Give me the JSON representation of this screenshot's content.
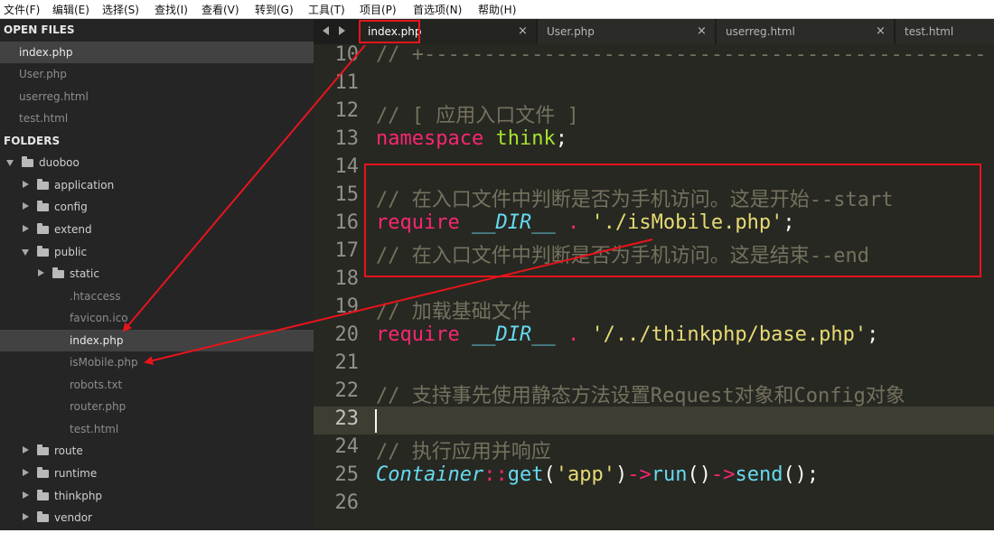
{
  "menu": [
    "文件(F)",
    "编辑(E)",
    "选择(S)",
    "查找(I)",
    "查看(V)",
    "转到(G)",
    "工具(T)",
    "项目(P)",
    "首选项(N)",
    "帮助(H)"
  ],
  "sidebar": {
    "open_files_header": "OPEN FILES",
    "open_files": [
      "index.php",
      "User.php",
      "userreg.html",
      "test.html"
    ],
    "folders_header": "FOLDERS",
    "tree": [
      {
        "label": "duoboo",
        "type": "folder",
        "expanded": true
      },
      {
        "label": "application",
        "type": "folder",
        "expanded": false
      },
      {
        "label": "config",
        "type": "folder",
        "expanded": false
      },
      {
        "label": "extend",
        "type": "folder",
        "expanded": false
      },
      {
        "label": "public",
        "type": "folder",
        "expanded": true
      },
      {
        "label": "static",
        "type": "folder",
        "expanded": false
      },
      {
        "label": ".htaccess",
        "type": "file"
      },
      {
        "label": "favicon.ico",
        "type": "file"
      },
      {
        "label": "index.php",
        "type": "file",
        "selected": true
      },
      {
        "label": "isMobile.php",
        "type": "file"
      },
      {
        "label": "robots.txt",
        "type": "file"
      },
      {
        "label": "router.php",
        "type": "file"
      },
      {
        "label": "test.html",
        "type": "file"
      },
      {
        "label": "route",
        "type": "folder",
        "expanded": false
      },
      {
        "label": "runtime",
        "type": "folder",
        "expanded": false
      },
      {
        "label": "thinkphp",
        "type": "folder",
        "expanded": false
      },
      {
        "label": "vendor",
        "type": "folder",
        "expanded": false
      }
    ]
  },
  "tabs": [
    {
      "label": "index.php",
      "active": true
    },
    {
      "label": "User.php",
      "active": false
    },
    {
      "label": "userreg.html",
      "active": false
    },
    {
      "label": "test.html",
      "active": false
    }
  ],
  "tab_close_glyph": "×",
  "editor": {
    "current_line": 23,
    "lines": [
      {
        "n": "10",
        "tokens": [
          {
            "t": "// +-----------------------------------------------",
            "c": "cmt"
          }
        ]
      },
      {
        "n": "11",
        "tokens": []
      },
      {
        "n": "12",
        "tokens": [
          {
            "t": "// [ 应用入口文件 ]",
            "c": "cmt"
          }
        ]
      },
      {
        "n": "13",
        "tokens": [
          {
            "t": "namespace",
            "c": "kw"
          },
          {
            "t": " ",
            "c": "pl"
          },
          {
            "t": "think",
            "c": "ns"
          },
          {
            "t": ";",
            "c": "pl"
          }
        ]
      },
      {
        "n": "14",
        "tokens": []
      },
      {
        "n": "15",
        "tokens": [
          {
            "t": "// 在入口文件中判断是否为手机访问。这是开始--start",
            "c": "cmt"
          }
        ]
      },
      {
        "n": "16",
        "tokens": [
          {
            "t": "require",
            "c": "kw"
          },
          {
            "t": " ",
            "c": "pl"
          },
          {
            "t": "__DIR__",
            "c": "cls"
          },
          {
            "t": " ",
            "c": "pl"
          },
          {
            "t": ".",
            "c": "kw"
          },
          {
            "t": " ",
            "c": "pl"
          },
          {
            "t": "'./isMobile.php'",
            "c": "str"
          },
          {
            "t": ";",
            "c": "pl"
          }
        ]
      },
      {
        "n": "17",
        "tokens": [
          {
            "t": "// 在入口文件中判断是否为手机访问。这是结束--end",
            "c": "cmt"
          }
        ]
      },
      {
        "n": "18",
        "tokens": []
      },
      {
        "n": "19",
        "tokens": [
          {
            "t": "// 加载基础文件",
            "c": "cmt"
          }
        ]
      },
      {
        "n": "20",
        "tokens": [
          {
            "t": "require",
            "c": "kw"
          },
          {
            "t": " ",
            "c": "pl"
          },
          {
            "t": "__DIR__",
            "c": "cls"
          },
          {
            "t": " ",
            "c": "pl"
          },
          {
            "t": ".",
            "c": "kw"
          },
          {
            "t": " ",
            "c": "pl"
          },
          {
            "t": "'/../thinkphp/base.php'",
            "c": "str"
          },
          {
            "t": ";",
            "c": "pl"
          }
        ]
      },
      {
        "n": "21",
        "tokens": []
      },
      {
        "n": "22",
        "tokens": [
          {
            "t": "// 支持事先使用静态方法设置Request对象和Config对象",
            "c": "cmt"
          }
        ]
      },
      {
        "n": "23",
        "tokens": []
      },
      {
        "n": "24",
        "tokens": [
          {
            "t": "// 执行应用并响应",
            "c": "cmt"
          }
        ]
      },
      {
        "n": "25",
        "tokens": [
          {
            "t": "Container",
            "c": "cls"
          },
          {
            "t": "::",
            "c": "kw"
          },
          {
            "t": "get",
            "c": "fn"
          },
          {
            "t": "(",
            "c": "pl"
          },
          {
            "t": "'app'",
            "c": "str"
          },
          {
            "t": ")",
            "c": "pl"
          },
          {
            "t": "->",
            "c": "kw"
          },
          {
            "t": "run",
            "c": "fn"
          },
          {
            "t": "()",
            "c": "pl"
          },
          {
            "t": "->",
            "c": "kw"
          },
          {
            "t": "send",
            "c": "fn"
          },
          {
            "t": "();",
            "c": "pl"
          }
        ]
      },
      {
        "n": "26",
        "tokens": []
      }
    ]
  },
  "colors": {
    "annotation": "#e8141b",
    "sidebar_bg": "#252526",
    "editor_bg": "#272822",
    "comment": "#75715e",
    "keyword": "#f92672",
    "string": "#e6db74",
    "constant": "#66d9ef",
    "namespace": "#a6e22e"
  },
  "icons": {
    "nav_left": "triangle-left-icon",
    "nav_right": "triangle-right-icon",
    "folder": "folder-icon",
    "expand": "triangle-icon"
  }
}
